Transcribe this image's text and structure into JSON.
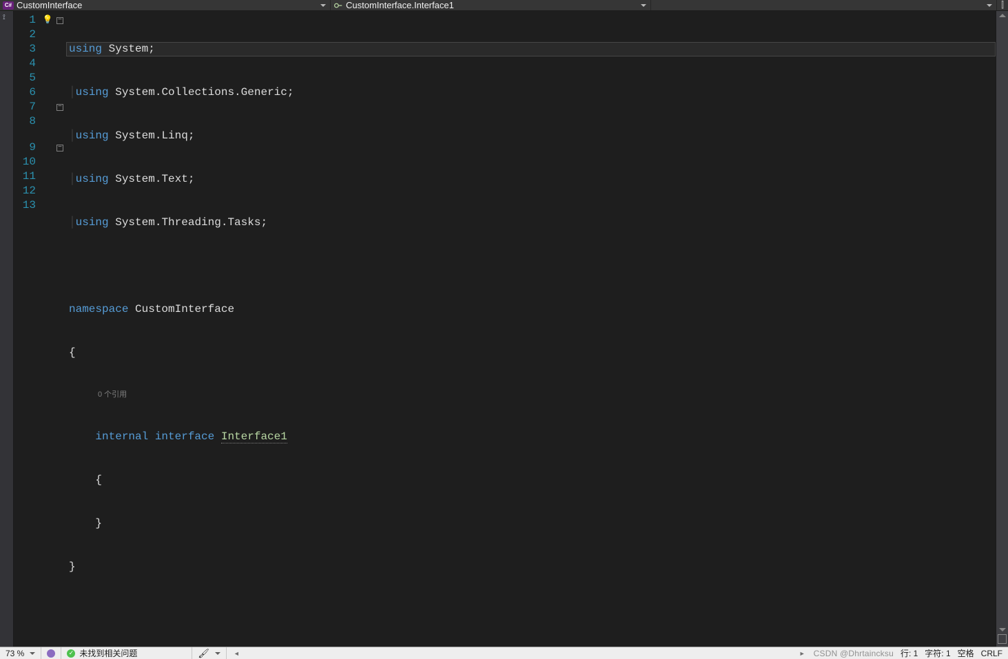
{
  "nav": {
    "class_dropdown": "CustomInterface",
    "member_dropdown": "CustomInterface.Interface1"
  },
  "code": {
    "line_numbers": [
      "1",
      "2",
      "3",
      "4",
      "5",
      "6",
      "7",
      "8",
      "9",
      "10",
      "11",
      "12",
      "13"
    ],
    "codelens": "0 个引用",
    "lines": {
      "l1_kw": "using",
      "l1_rest": " System;",
      "l2_kw": "using",
      "l2_rest": " System.Collections.Generic;",
      "l3_kw": "using",
      "l3_rest": " System.Linq;",
      "l4_kw": "using",
      "l4_rest": " System.Text;",
      "l5_kw": "using",
      "l5_rest": " System.Threading.Tasks;",
      "l6": "",
      "l7_kw": "namespace",
      "l7_rest": " CustomInterface",
      "l8": "{",
      "l9_mod": "internal",
      "l9_kw": " interface ",
      "l9_type": "Interface1",
      "l10": "    {",
      "l11": "    }",
      "l12": "}",
      "l13": ""
    }
  },
  "status": {
    "zoom": "73 %",
    "issues": "未找到相关问题",
    "line_label": "行: 1",
    "char_label": "字符: 1",
    "spaces_label": "空格",
    "eol_label": "CRLF",
    "watermark": "CSDN @Dhrtaincksu"
  },
  "icons": {
    "cs_badge": "C#",
    "bulb": "💡",
    "check": "✓",
    "brush": "🖌",
    "split": "⫿"
  }
}
